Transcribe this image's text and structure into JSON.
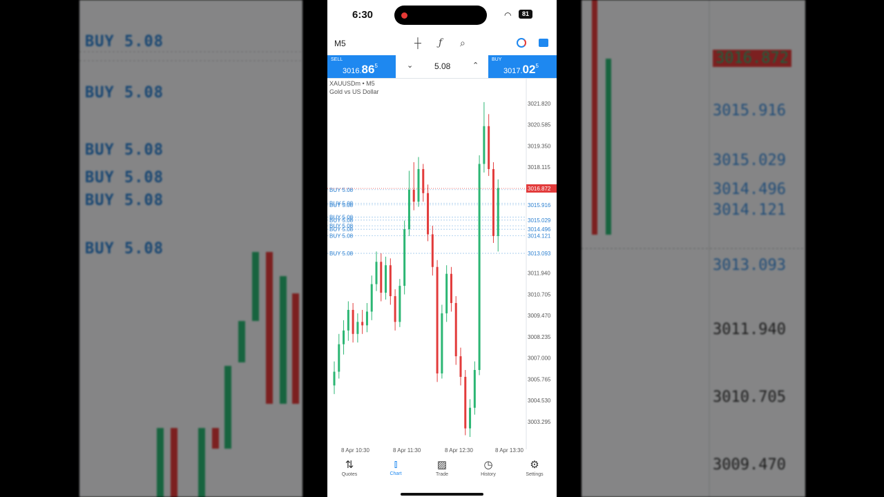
{
  "status_bar": {
    "time": "6:30",
    "battery": "81"
  },
  "toolbar": {
    "timeframe": "M5"
  },
  "trade_panel": {
    "sell_label": "SELL",
    "sell_price_main": "3016.",
    "sell_price_big": "86",
    "sell_price_sup": "5",
    "volume": "5.08",
    "buy_label": "BUY",
    "buy_price_main": "3017.",
    "buy_price_big": "02",
    "buy_price_sup": "5"
  },
  "symbol": {
    "name": "XAUUSDm • M5",
    "description": "Gold vs US Dollar"
  },
  "chart_data": {
    "type": "candlestick",
    "y_axis_ticks": [
      "3021.820",
      "3020.585",
      "3019.350",
      "3018.115",
      "3015.916",
      "3015.029",
      "3014.496",
      "3014.121",
      "3013.093",
      "3011.940",
      "3010.705",
      "3009.470",
      "3008.235",
      "3007.000",
      "3005.765",
      "3004.530",
      "3003.295"
    ],
    "x_axis_ticks": [
      "8 Apr 10:30",
      "8 Apr 11:30",
      "8 Apr 12:30",
      "8 Apr 13:30"
    ],
    "current_price_label": "3016.872",
    "position_lines": [
      {
        "label": "BUY 5.08",
        "price": 3016.8
      },
      {
        "label": "BUY 5.08",
        "price": 3016.0
      },
      {
        "label": "BUY 5.08",
        "price": 3015.916
      },
      {
        "label": "BUY 5.08",
        "price": 3015.2
      },
      {
        "label": "BUY 5.08",
        "price": 3015.029
      },
      {
        "label": "BUY 5.08",
        "price": 3014.7
      },
      {
        "label": "BUY 5.08",
        "price": 3014.496
      },
      {
        "label": "BUY 5.08",
        "price": 3014.121
      },
      {
        "label": "BUY 5.08",
        "price": 3013.093
      }
    ],
    "candles": [
      {
        "o": 3005.4,
        "c": 3006.2,
        "h": 3006.8,
        "l": 3004.9
      },
      {
        "o": 3006.2,
        "c": 3007.8,
        "h": 3008.4,
        "l": 3005.8
      },
      {
        "o": 3007.8,
        "c": 3008.6,
        "h": 3009.2,
        "l": 3007.2
      },
      {
        "o": 3008.6,
        "c": 3009.8,
        "h": 3010.3,
        "l": 3008.0
      },
      {
        "o": 3009.8,
        "c": 3008.4,
        "h": 3010.2,
        "l": 3007.9
      },
      {
        "o": 3008.4,
        "c": 3009.1,
        "h": 3009.6,
        "l": 3007.9
      },
      {
        "o": 3009.1,
        "c": 3008.9,
        "h": 3009.8,
        "l": 3008.4
      },
      {
        "o": 3008.9,
        "c": 3009.7,
        "h": 3010.2,
        "l": 3008.5
      },
      {
        "o": 3009.7,
        "c": 3011.3,
        "h": 3011.8,
        "l": 3009.2
      },
      {
        "o": 3011.3,
        "c": 3012.6,
        "h": 3013.2,
        "l": 3010.9
      },
      {
        "o": 3012.6,
        "c": 3010.8,
        "h": 3013.1,
        "l": 3010.3
      },
      {
        "o": 3010.8,
        "c": 3012.4,
        "h": 3012.9,
        "l": 3010.4
      },
      {
        "o": 3012.4,
        "c": 3010.6,
        "h": 3012.8,
        "l": 3010.1
      },
      {
        "o": 3010.6,
        "c": 3009.1,
        "h": 3011.0,
        "l": 3008.6
      },
      {
        "o": 3009.1,
        "c": 3011.2,
        "h": 3011.6,
        "l": 3008.8
      },
      {
        "o": 3011.2,
        "c": 3014.5,
        "h": 3015.0,
        "l": 3010.7
      },
      {
        "o": 3014.5,
        "c": 3016.8,
        "h": 3017.9,
        "l": 3014.1
      },
      {
        "o": 3016.8,
        "c": 3016.1,
        "h": 3018.4,
        "l": 3015.6
      },
      {
        "o": 3016.1,
        "c": 3018.0,
        "h": 3018.7,
        "l": 3015.8
      },
      {
        "o": 3018.0,
        "c": 3016.6,
        "h": 3018.3,
        "l": 3016.1
      },
      {
        "o": 3016.6,
        "c": 3014.2,
        "h": 3017.1,
        "l": 3013.8
      },
      {
        "o": 3014.2,
        "c": 3012.3,
        "h": 3014.7,
        "l": 3011.8
      },
      {
        "o": 3012.3,
        "c": 3006.1,
        "h": 3012.7,
        "l": 3005.6
      },
      {
        "o": 3006.1,
        "c": 3009.6,
        "h": 3010.1,
        "l": 3005.8
      },
      {
        "o": 3009.6,
        "c": 3011.9,
        "h": 3012.4,
        "l": 3009.1
      },
      {
        "o": 3011.9,
        "c": 3010.2,
        "h": 3012.3,
        "l": 3009.7
      },
      {
        "o": 3010.2,
        "c": 3007.1,
        "h": 3010.6,
        "l": 3006.6
      },
      {
        "o": 3007.1,
        "c": 3005.9,
        "h": 3007.6,
        "l": 3005.4
      },
      {
        "o": 3005.9,
        "c": 3002.9,
        "h": 3006.3,
        "l": 3002.5
      },
      {
        "o": 3002.9,
        "c": 3004.1,
        "h": 3004.6,
        "l": 3002.4
      },
      {
        "o": 3004.1,
        "c": 3006.3,
        "h": 3006.8,
        "l": 3003.7
      },
      {
        "o": 3006.3,
        "c": 3018.3,
        "h": 3018.8,
        "l": 3006.0
      },
      {
        "o": 3018.3,
        "c": 3020.5,
        "h": 3021.9,
        "l": 3017.8
      },
      {
        "o": 3020.5,
        "c": 3018.0,
        "h": 3021.2,
        "l": 3017.6
      },
      {
        "o": 3018.0,
        "c": 3014.1,
        "h": 3018.4,
        "l": 3013.7
      },
      {
        "o": 3014.1,
        "c": 3016.9,
        "h": 3017.4,
        "l": 3013.2
      }
    ]
  },
  "nav": {
    "quotes": "Quotes",
    "chart": "Chart",
    "trade": "Trade",
    "history": "History",
    "settings": "Settings"
  },
  "background": {
    "left_labels": [
      "BUY 5.08",
      "BUY 5.08",
      "BUY 5.08",
      "BUY 5.08",
      "BUY 5.08",
      "BUY 5.08"
    ],
    "right_prices": [
      "3016.872",
      "3015.916",
      "3015.029",
      "3014.496",
      "3014.121",
      "3013.093",
      "3011.940",
      "3010.705",
      "3009.470"
    ]
  }
}
